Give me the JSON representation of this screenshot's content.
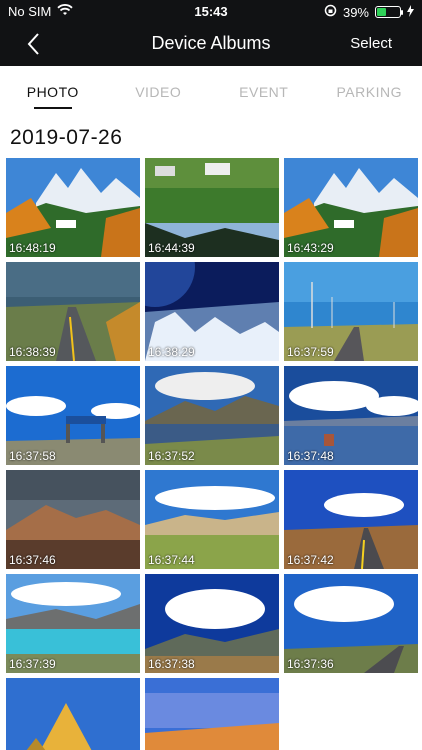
{
  "status": {
    "carrier": "No SIM",
    "time": "15:43",
    "battery": "39%",
    "battery_level": 0.39
  },
  "nav": {
    "title": "Device Albums",
    "select_label": "Select"
  },
  "tabs": [
    {
      "label": "PHOTO",
      "active": true
    },
    {
      "label": "VIDEO",
      "active": false
    },
    {
      "label": "EVENT",
      "active": false
    },
    {
      "label": "PARKING",
      "active": false
    }
  ],
  "date_header": "2019-07-26",
  "photos": [
    {
      "time": "16:48:19",
      "scene": "dolomites"
    },
    {
      "time": "16:44:39",
      "scene": "reflection"
    },
    {
      "time": "16:43:29",
      "scene": "dolomites"
    },
    {
      "time": "16:38:39",
      "scene": "road-storm"
    },
    {
      "time": "16:38:29",
      "scene": "aerial-snow"
    },
    {
      "time": "16:37:59",
      "scene": "road-powerlines"
    },
    {
      "time": "16:37:58",
      "scene": "gate-sky"
    },
    {
      "time": "16:37:52",
      "scene": "lake-mountains"
    },
    {
      "time": "16:37:48",
      "scene": "lake-cloud"
    },
    {
      "time": "16:37:46",
      "scene": "brown-hills"
    },
    {
      "time": "16:37:44",
      "scene": "grassland"
    },
    {
      "time": "16:37:42",
      "scene": "road-blue"
    },
    {
      "time": "16:37:39",
      "scene": "turquoise-lake"
    },
    {
      "time": "16:37:38",
      "scene": "clouds-mountain"
    },
    {
      "time": "16:37:36",
      "scene": "road-clouds"
    },
    {
      "time": "",
      "scene": "everest"
    },
    {
      "time": "",
      "scene": "sunset-lake"
    }
  ],
  "colors": {
    "nav_bg": "#111214",
    "active_tab": "#111111",
    "inactive_tab": "#b7b7b7",
    "battery_fill": "#2fd158"
  }
}
